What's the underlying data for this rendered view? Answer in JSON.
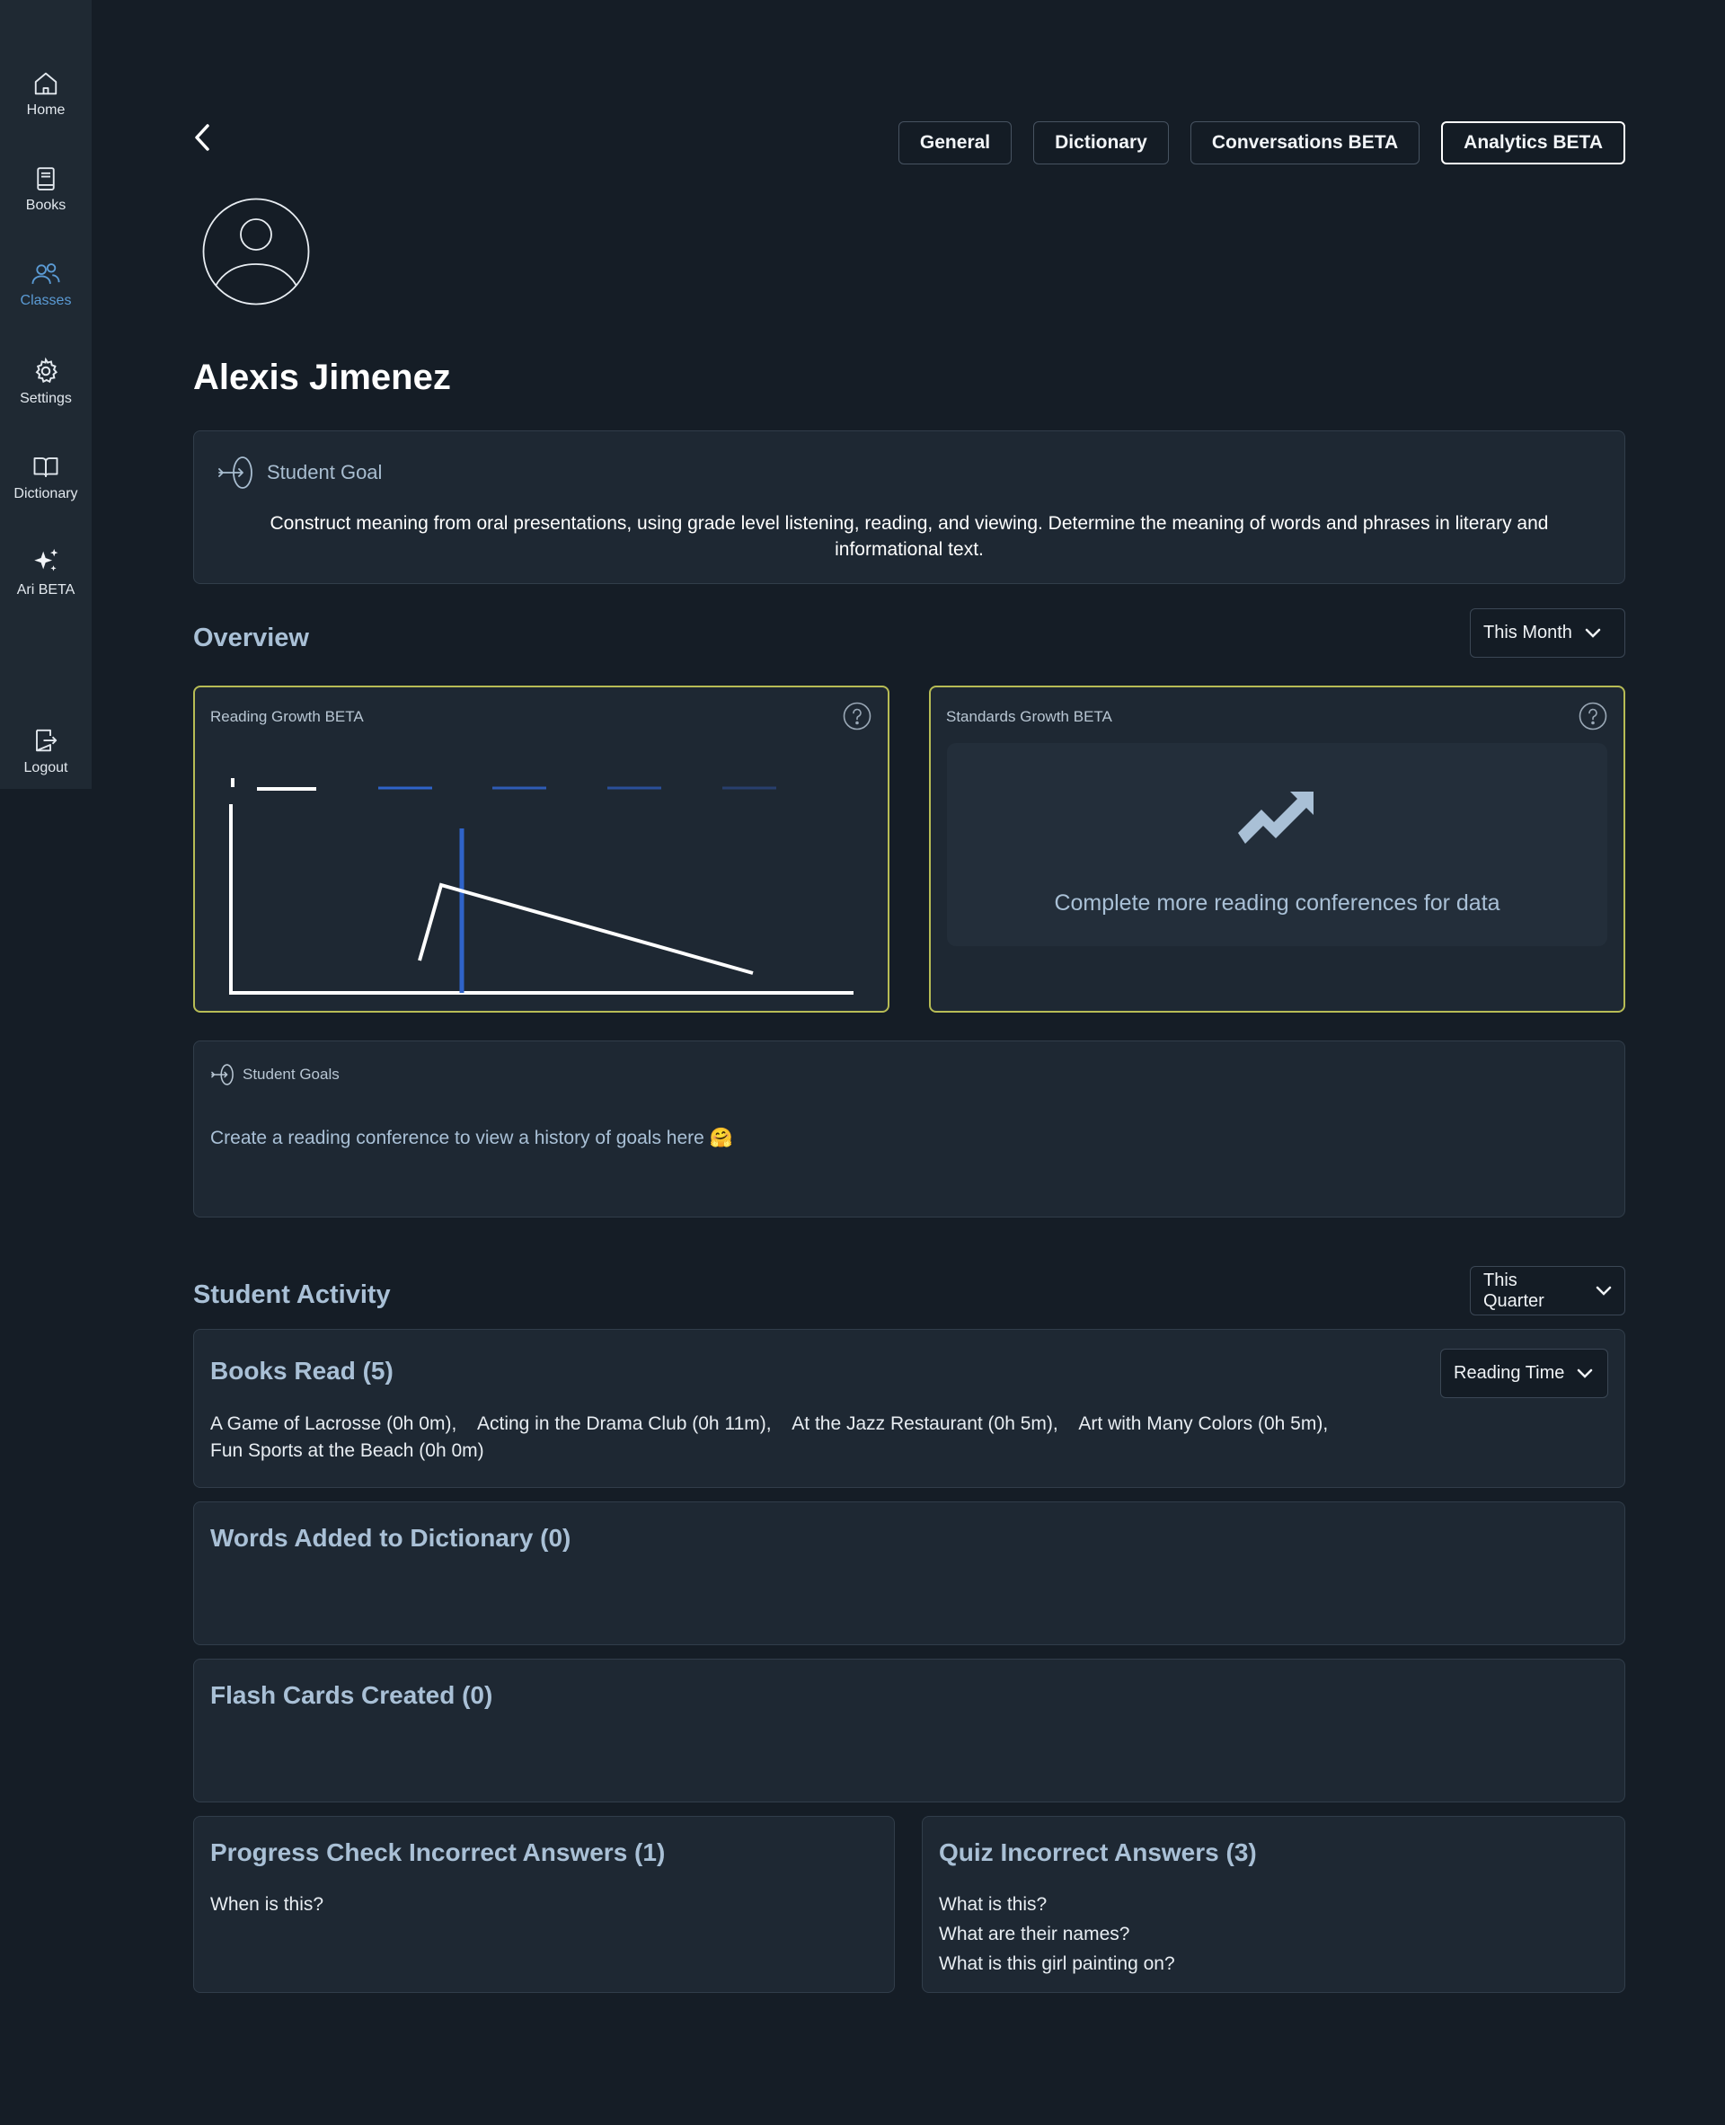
{
  "sidebar": {
    "items": [
      {
        "label": "Home",
        "icon": "home-icon"
      },
      {
        "label": "Books",
        "icon": "book-icon"
      },
      {
        "label": "Classes",
        "icon": "users-icon",
        "active": true
      },
      {
        "label": "Settings",
        "icon": "gear-icon"
      },
      {
        "label": "Dictionary",
        "icon": "open-book-icon"
      },
      {
        "label": "Ari BETA",
        "icon": "sparkle-icon"
      }
    ],
    "logout": {
      "label": "Logout",
      "icon": "logout-icon"
    }
  },
  "tabs": [
    "General",
    "Dictionary",
    "Conversations BETA",
    "Analytics BETA"
  ],
  "active_tab": "Analytics BETA",
  "student": {
    "name": "Alexis Jimenez"
  },
  "goal": {
    "label": "Student Goal",
    "text": "Construct meaning from oral presentations, using grade level listening, reading, and viewing. Determine the meaning of words and phrases in literary and informational text."
  },
  "overview": {
    "title": "Overview",
    "period": "This Month",
    "reading_growth": {
      "title": "Reading Growth BETA"
    },
    "standards_growth": {
      "title": "Standards Growth BETA",
      "empty_message": "Complete more reading conferences for data"
    }
  },
  "student_goals": {
    "label": "Student Goals",
    "message": "Create a reading conference to view a history of goals here 🤗"
  },
  "activity": {
    "title": "Student Activity",
    "period": "This Quarter",
    "books_read": {
      "title": "Books Read (5)",
      "sort": "Reading Time",
      "books": [
        "A Game of Lacrosse (0h 0m),",
        "Acting in the Drama Club (0h 11m),",
        "At the Jazz Restaurant (0h 5m),",
        "Art with Many Colors (0h 5m),",
        "Fun Sports at the Beach (0h 0m)"
      ]
    },
    "words_added": {
      "title": "Words Added to Dictionary (0)"
    },
    "flash_cards": {
      "title": "Flash Cards Created (0)"
    },
    "progress_check": {
      "title": "Progress Check Incorrect Answers (1)",
      "answers": [
        "When is this?"
      ]
    },
    "quiz": {
      "title": "Quiz Incorrect Answers (3)",
      "answers": [
        "What is this?",
        "What are their names?",
        "What is this girl painting on?"
      ]
    }
  },
  "colors": {
    "background": "#151d26",
    "sidebar": "#1f2933",
    "card": "#1e2833",
    "accent": "#5b9bd5",
    "chart_border": "#b7bc55",
    "chart_blue": "#2f63c9"
  }
}
